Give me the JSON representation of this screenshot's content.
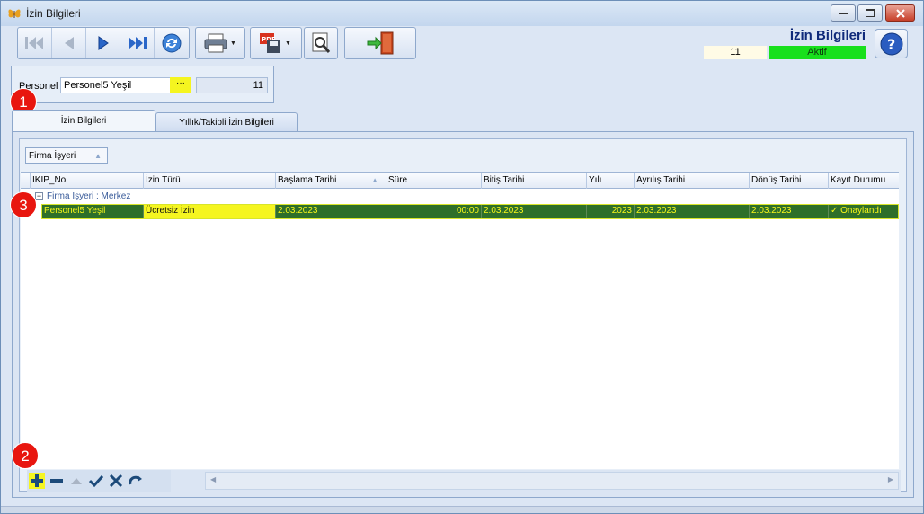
{
  "window": {
    "title": "İzin Bilgileri"
  },
  "header": {
    "title": "İzin Bilgileri",
    "record_id": "11",
    "status": "Aktif",
    "status_color": "#18e01c"
  },
  "personel": {
    "label": "Personel",
    "value": "Personel5 Yeşil",
    "lookup": "···",
    "id": "11"
  },
  "markers": {
    "m1": "1",
    "m2": "2",
    "m3": "3"
  },
  "tabs": [
    {
      "label": "İzin Bilgileri",
      "active": true
    },
    {
      "label": "Yıllık/Takipli İzin Bilgileri",
      "active": false
    }
  ],
  "grid": {
    "group_by": "Firma İşyeri",
    "columns": [
      "IKIP_No",
      "İzin Türü",
      "Başlama Tarihi",
      "Süre",
      "Bitiş Tarihi",
      "Yılı",
      "Ayrılış Tarihi",
      "Dönüş Tarihi",
      "Kayıt Durumu"
    ],
    "group_row": "Firma İşyeri : Merkez",
    "rows": [
      {
        "ikip_no": "Personel5 Yeşil",
        "izin_turu": "Ücretsiz İzin",
        "baslama": "2.03.2023",
        "sure": "00:00",
        "bitis": "2.03.2023",
        "yili": "2023",
        "ayrilis": "2.03.2023",
        "donus": "2.03.2023",
        "durum": "✓ Onaylandı"
      }
    ]
  },
  "icons": {
    "toolbar": [
      "first-icon",
      "prev-icon",
      "next-icon",
      "last-icon",
      "refresh-icon",
      "print-icon",
      "pdf-save-icon",
      "preview-icon",
      "exit-icon"
    ],
    "nav": [
      "add-icon",
      "remove-icon",
      "up-icon",
      "check-icon",
      "cancel-icon",
      "redo-icon"
    ]
  }
}
